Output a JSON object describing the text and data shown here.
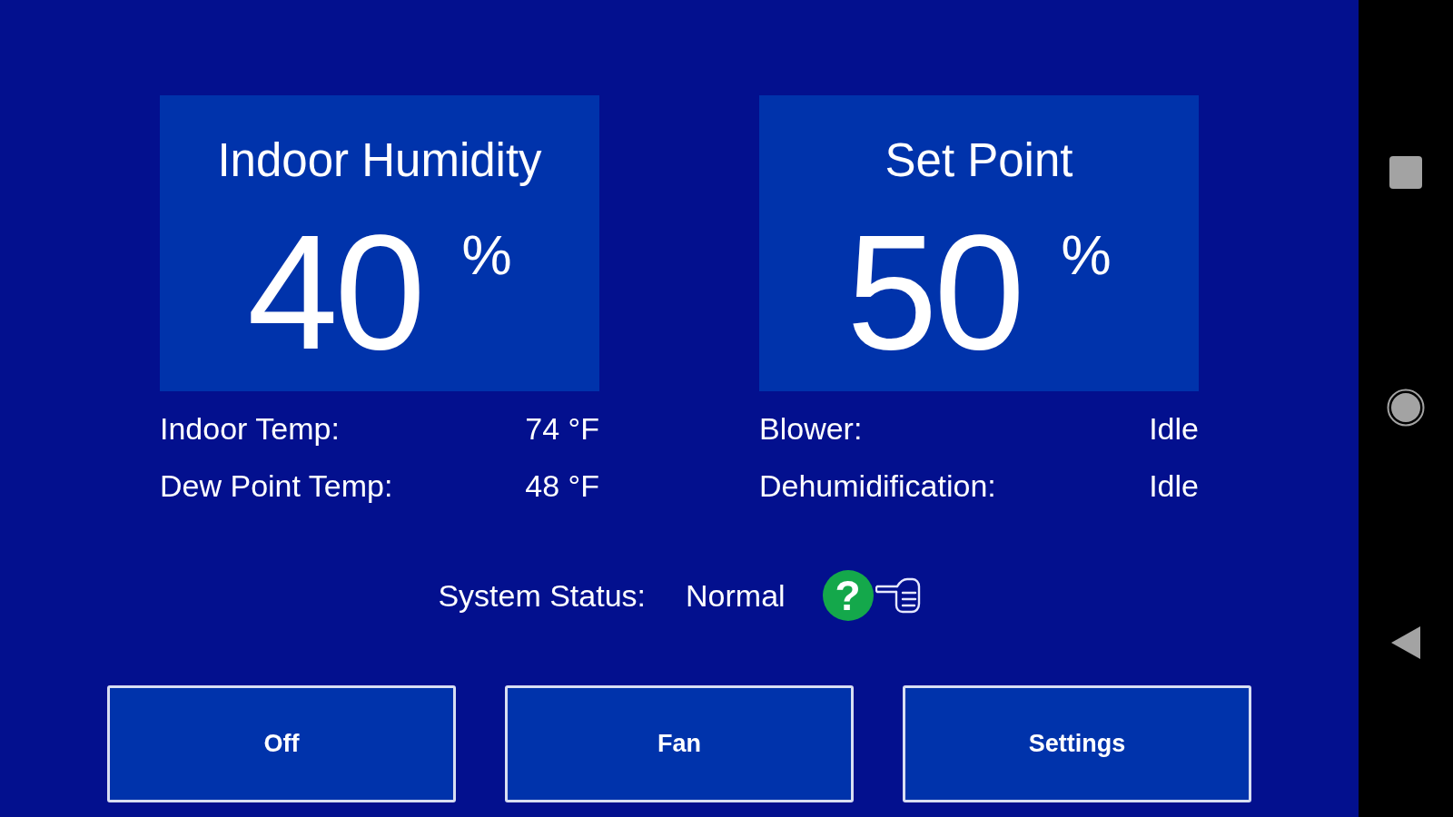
{
  "cards": [
    {
      "title": "Indoor Humidity",
      "value": "40",
      "unit": "%",
      "details": [
        {
          "label": "Indoor Temp:",
          "value": "74 °F"
        },
        {
          "label": "Dew Point Temp:",
          "value": "48 °F"
        }
      ]
    },
    {
      "title": "Set Point",
      "value": "50",
      "unit": "%",
      "details": [
        {
          "label": "Blower:",
          "value": "Idle"
        },
        {
          "label": "Dehumidification:",
          "value": "Idle"
        }
      ]
    }
  ],
  "system_status": {
    "label": "System Status:",
    "value": "Normal",
    "help_symbol": "?"
  },
  "buttons": [
    {
      "label": "Off"
    },
    {
      "label": "Fan"
    },
    {
      "label": "Settings"
    }
  ]
}
